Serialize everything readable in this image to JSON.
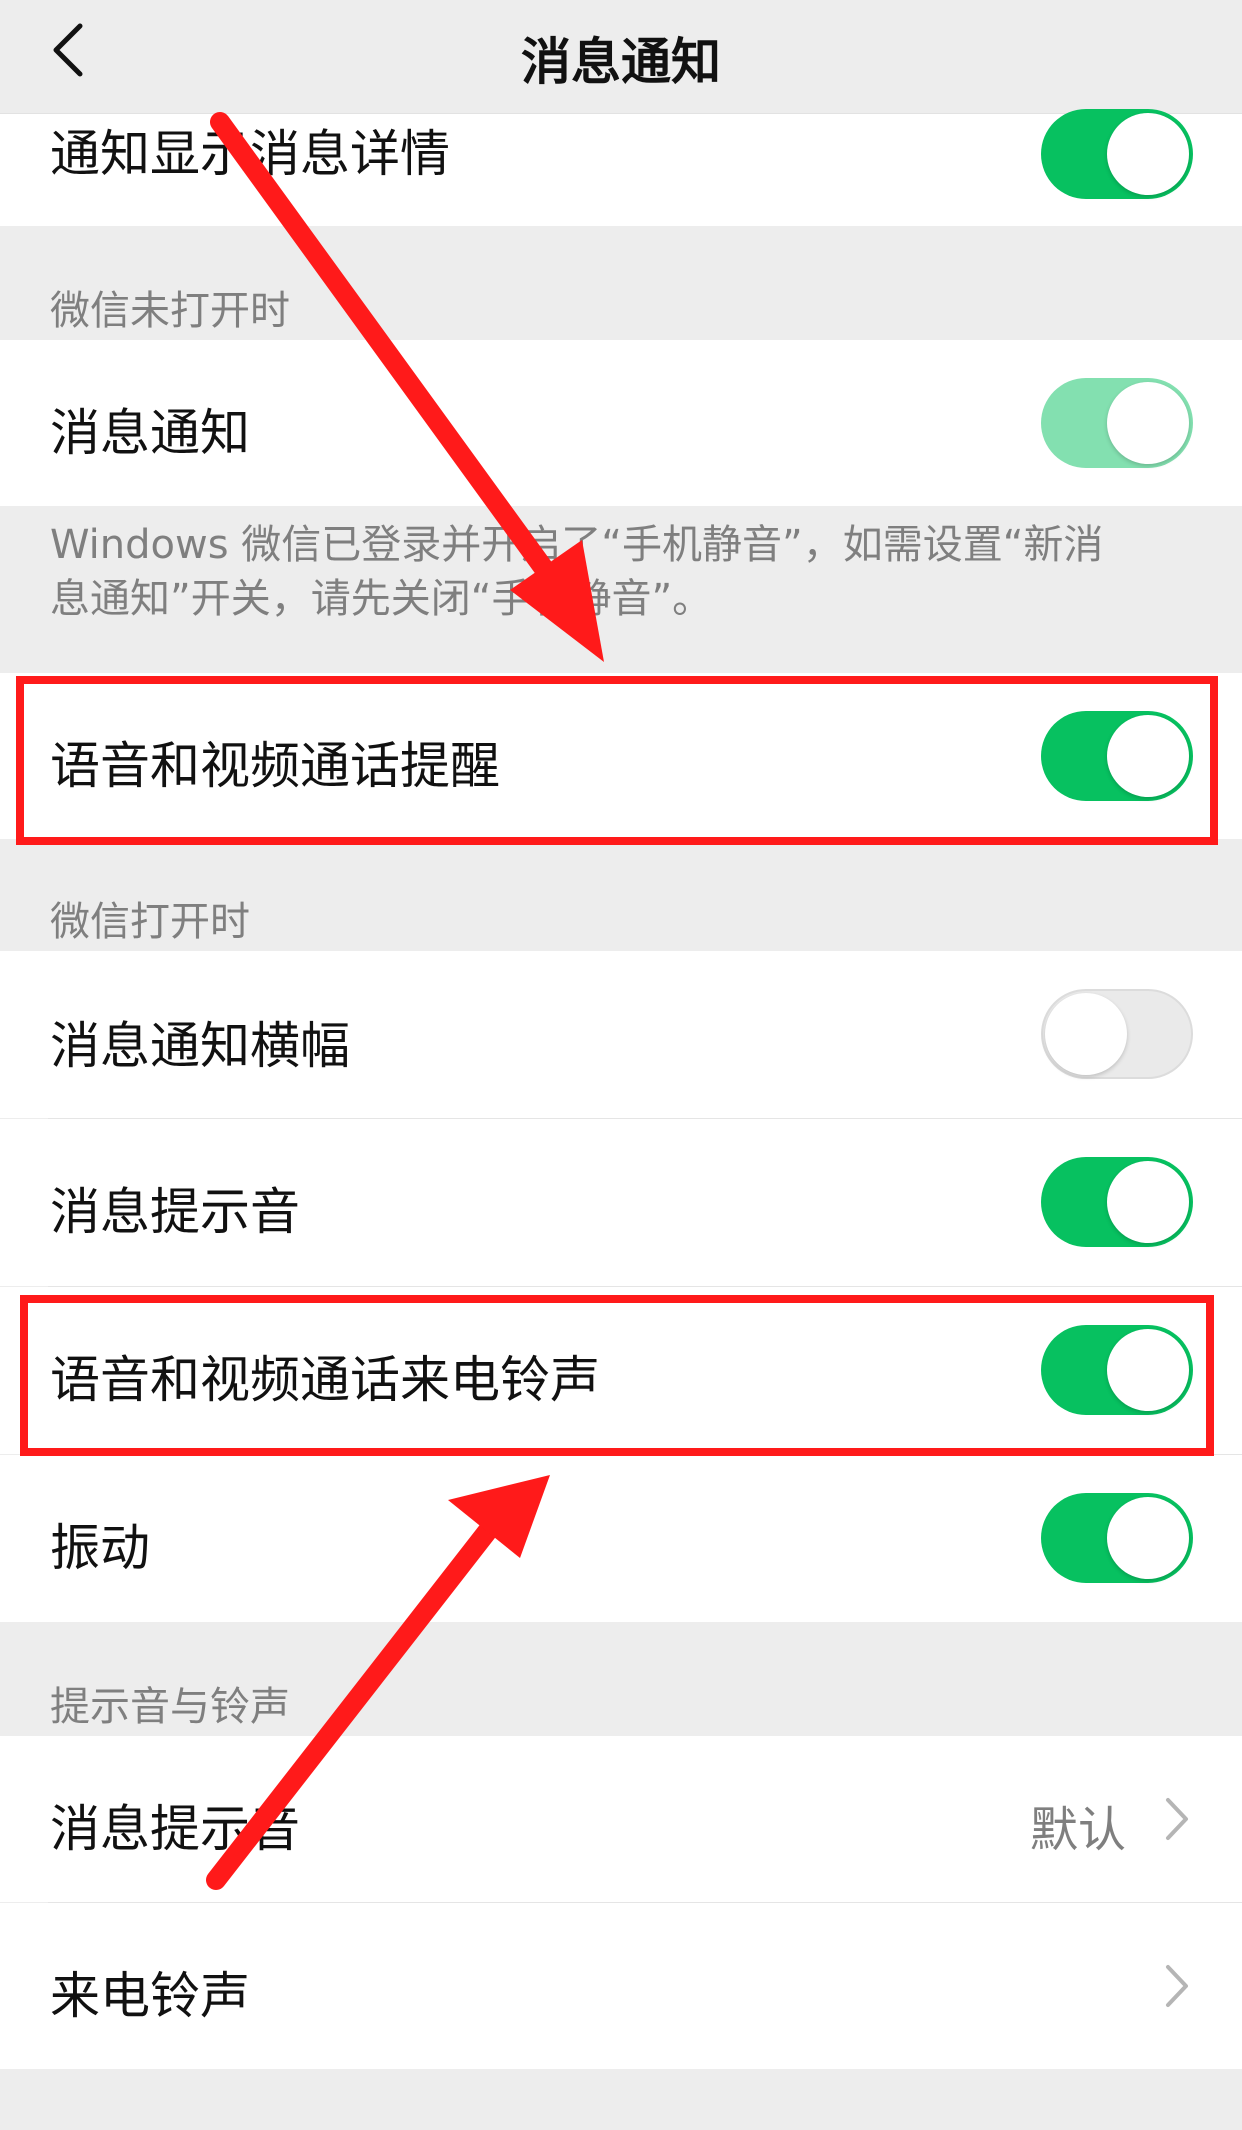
{
  "nav": {
    "title": "消息通知",
    "back_icon": "chevron-left-icon"
  },
  "rows": {
    "show_details": {
      "label": "通知显示消息详情",
      "enabled": true
    },
    "notification": {
      "label": "消息通知",
      "enabled": true,
      "disabled_look": true
    },
    "call_reminder": {
      "label": "语音和视频通话提醒",
      "enabled": true
    },
    "banner": {
      "label": "消息通知横幅",
      "enabled": false
    },
    "msg_sound": {
      "label": "消息提示音",
      "enabled": true
    },
    "call_ringtone": {
      "label": "语音和视频通话来电铃声",
      "enabled": true
    },
    "vibrate": {
      "label": "振动",
      "enabled": true
    },
    "msg_tone": {
      "label": "消息提示音",
      "value": "默认"
    },
    "ringtone": {
      "label": "来电铃声"
    }
  },
  "sections": {
    "closed": "微信未打开时",
    "open": "微信打开时",
    "sounds": "提示音与铃声"
  },
  "note": {
    "line1": "Windows 微信已登录并开启了“手机静音”，如需设置“新消",
    "line2": "息通知”开关，请先关闭“手机静音”。"
  },
  "colors": {
    "toggle_on": "#07c160",
    "toggle_on_disabled": "#83e0b0",
    "annotation_red": "#ff1a1a"
  }
}
